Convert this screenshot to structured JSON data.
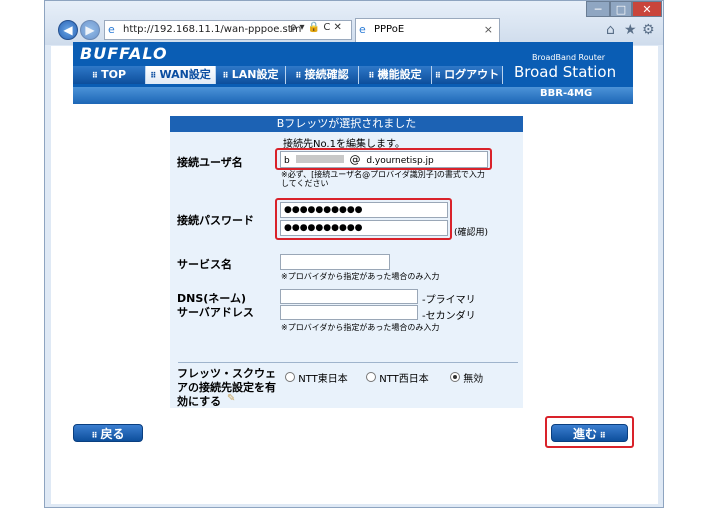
{
  "browser": {
    "address": "http://192.168.11.1/wan-pppoe.stm",
    "address_tools": "ρ ▾ 🔒 C ✕",
    "tab_title": "PPPoE",
    "tab_close": "×",
    "minimize": "─",
    "maximize": "□",
    "close": "✕",
    "home_icon": "⌂",
    "star_icon": "★",
    "gear_icon": "⚙"
  },
  "router": {
    "logo": "BUFFALO",
    "product_small": "BroadBand Router",
    "product": "Broad Station",
    "model": "BBR-4MG",
    "menu": [
      {
        "label": "TOP"
      },
      {
        "label": "WAN設定"
      },
      {
        "label": "LAN設定"
      },
      {
        "label": "接続確認"
      },
      {
        "label": "機能設定"
      },
      {
        "label": "ログアウト"
      }
    ]
  },
  "form": {
    "title": "Bフレッツが選択されました",
    "subtitle": "接続先No.1を編集します。",
    "user_label": "接続ユーザ名",
    "user_prefix": "b",
    "user_at": "@",
    "user_domain": "d.yournetisp.jp",
    "user_note": "※必ず、[接続ユーザ名@プロバイダ識別子]の書式で入力してください",
    "password_label": "接続パスワード",
    "password_value": "●●●●●●●●●●",
    "password_confirm_value": "●●●●●●●●●●",
    "password_confirm_note": "(確認用)",
    "service_label": "サービス名",
    "service_value": "",
    "service_note": "※プロバイダから指定があった場合のみ入力",
    "dns_label_1": "DNS(ネーム)",
    "dns_label_2": "サーバアドレス",
    "dns_primary_value": "",
    "dns_primary_note": "-プライマリ",
    "dns_secondary_value": "",
    "dns_secondary_note": "-セカンダリ",
    "dns_note": "※プロバイダから指定があった場合のみ入力",
    "flets_label": "フレッツ・スクウェアの接続先設定を有効にする",
    "flets_options": [
      {
        "label": "NTT東日本",
        "selected": false
      },
      {
        "label": "NTT西日本",
        "selected": false
      },
      {
        "label": "無効",
        "selected": true
      }
    ]
  },
  "buttons": {
    "back": "戻る",
    "next": "進む"
  }
}
